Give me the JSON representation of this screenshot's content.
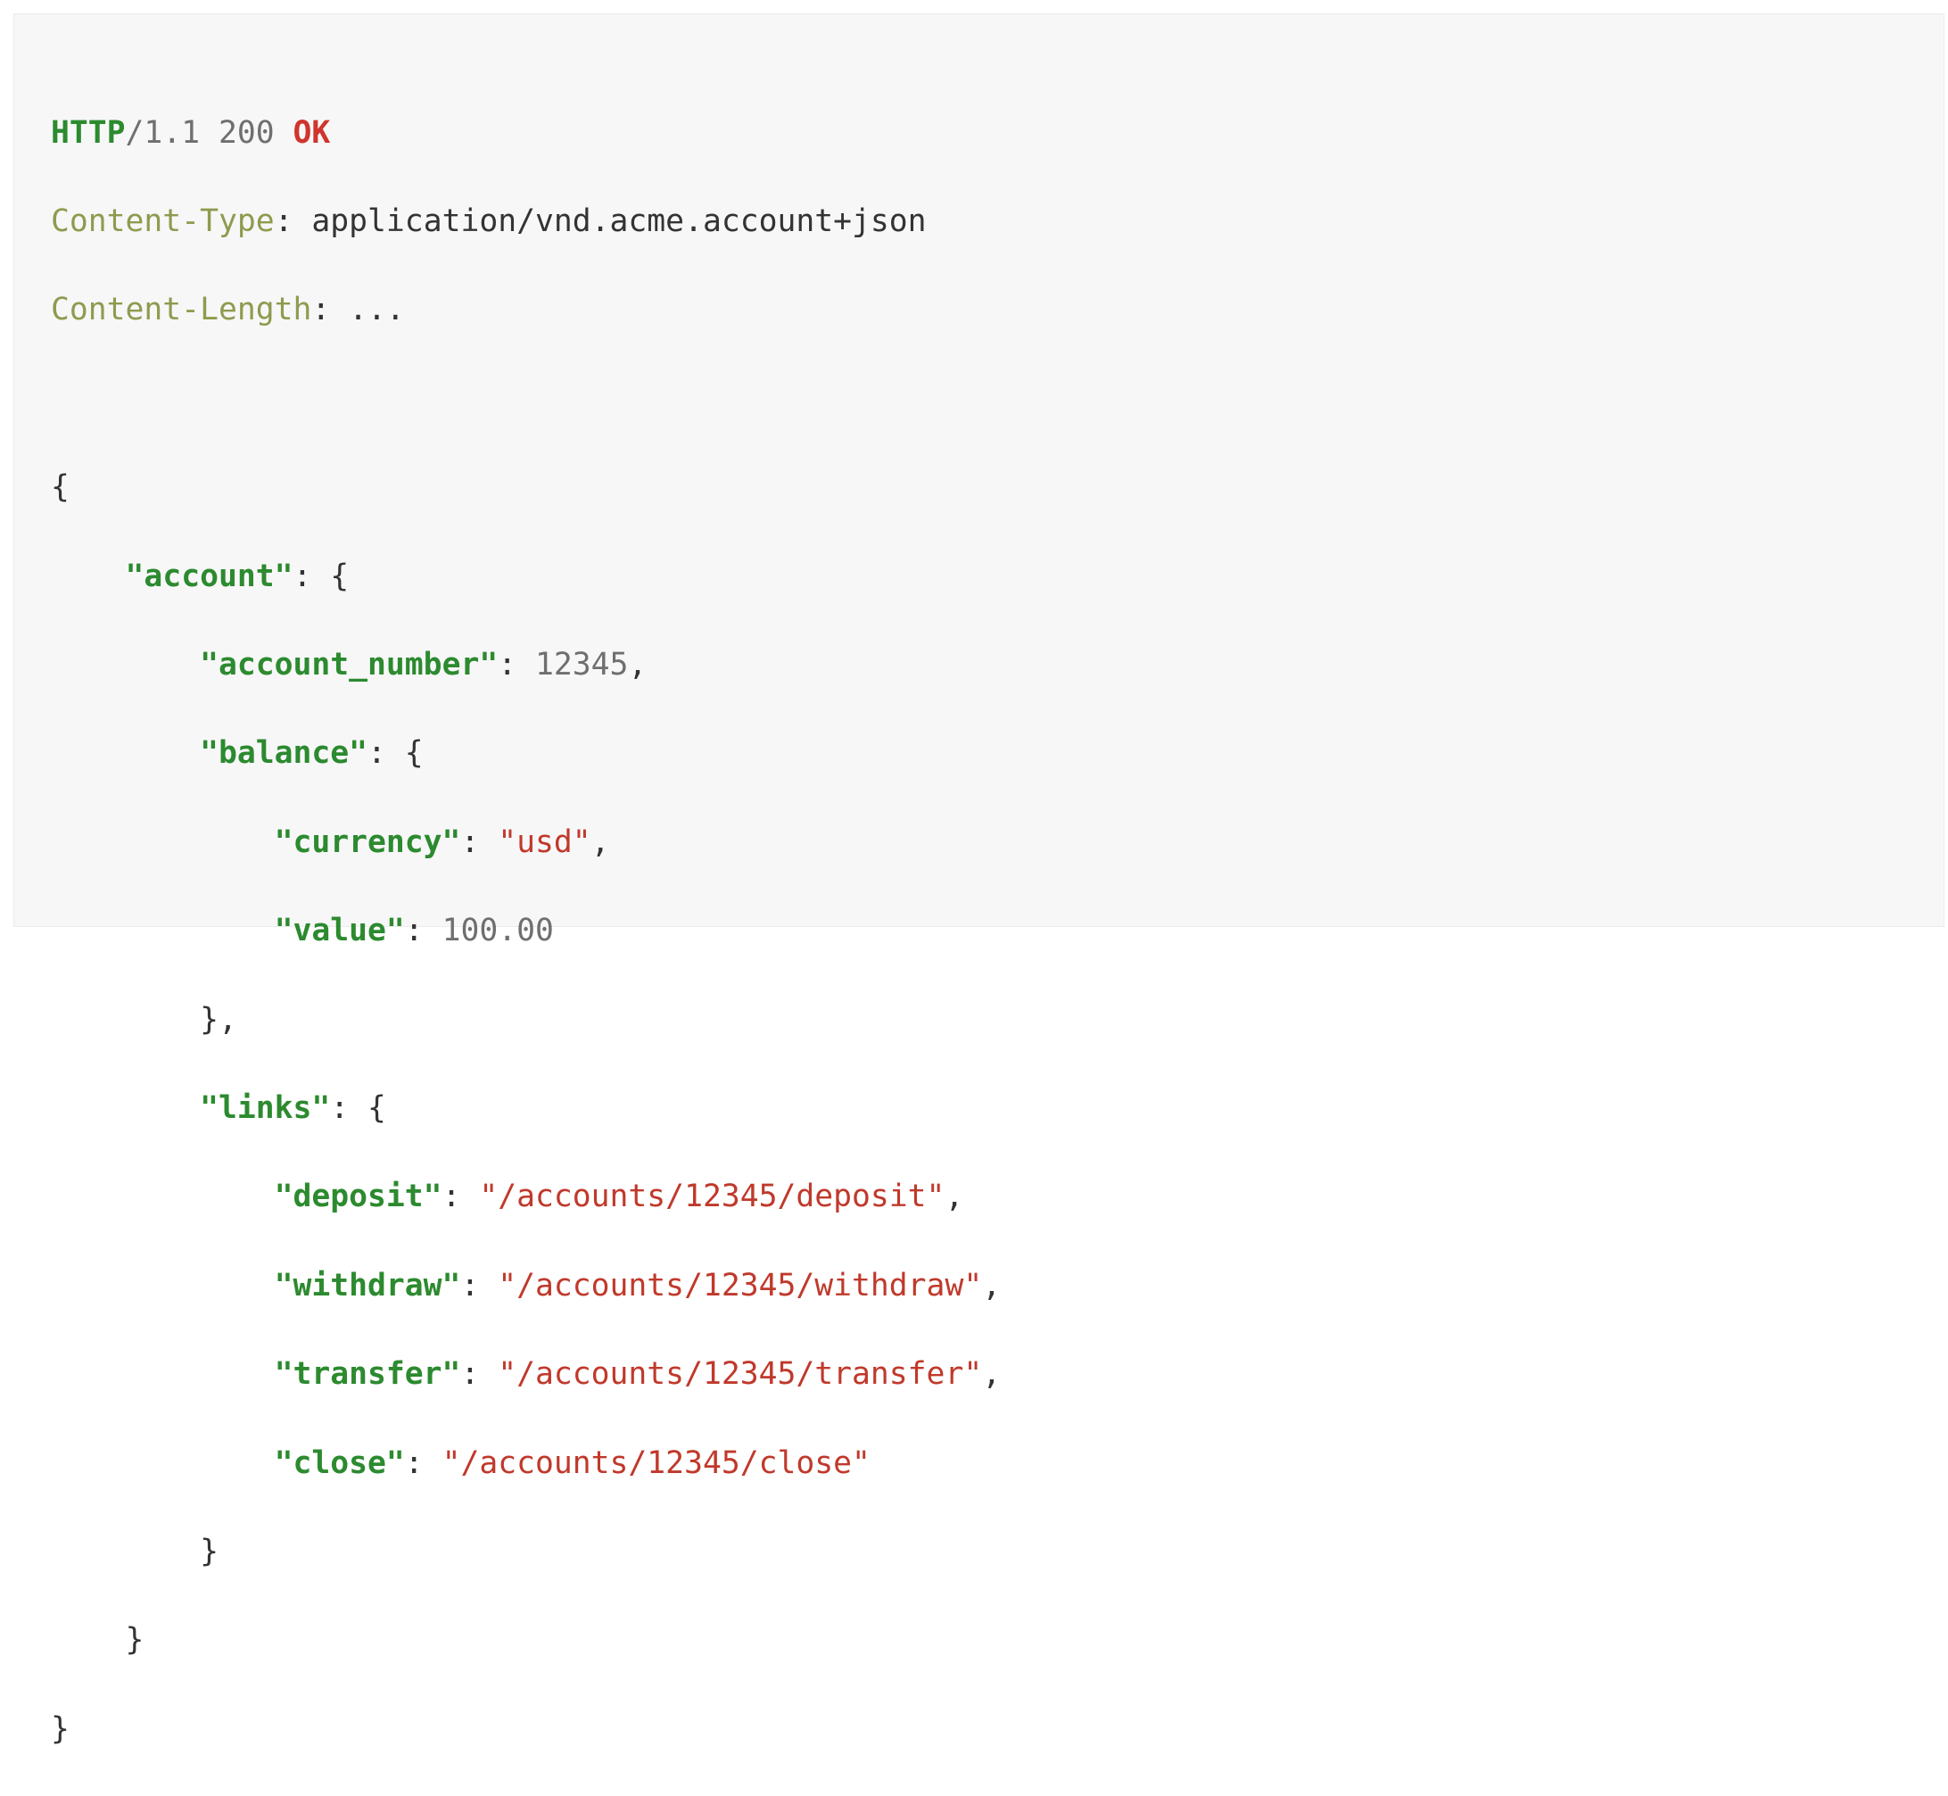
{
  "status_line": {
    "protocol": "HTTP",
    "version": "/1.1 200 ",
    "status": "OK"
  },
  "headers": [
    {
      "name": "Content-Type",
      "sep": ": ",
      "value": "application/vnd.acme.account+json"
    },
    {
      "name": "Content-Length",
      "sep": ": ",
      "value": "..."
    }
  ],
  "body": {
    "open": "{",
    "account_key": "\"account\"",
    "account_open": ": {",
    "account_number_key": "\"account_number\"",
    "account_number_value": "12345",
    "balance_key": "\"balance\"",
    "balance_open": ": {",
    "currency_key": "\"currency\"",
    "currency_value": "\"usd\"",
    "value_key": "\"value\"",
    "value_value": "100.00",
    "balance_close": "},",
    "links_key": "\"links\"",
    "links_open": ": {",
    "links": [
      {
        "key": "\"deposit\"",
        "value": "\"/accounts/12345/deposit\"",
        "trail": ","
      },
      {
        "key": "\"withdraw\"",
        "value": "\"/accounts/12345/withdraw\"",
        "trail": ","
      },
      {
        "key": "\"transfer\"",
        "value": "\"/accounts/12345/transfer\"",
        "trail": ","
      },
      {
        "key": "\"close\"",
        "value": "\"/accounts/12345/close\"",
        "trail": ""
      }
    ],
    "links_close": "}",
    "account_close": "}",
    "close": "}"
  },
  "colors": {
    "background": "#f7f7f8",
    "keyword_green": "#2c8a2f",
    "header_olive": "#8e9b4e",
    "string_red": "#c0392b",
    "number_gray": "#6f6f6f"
  }
}
